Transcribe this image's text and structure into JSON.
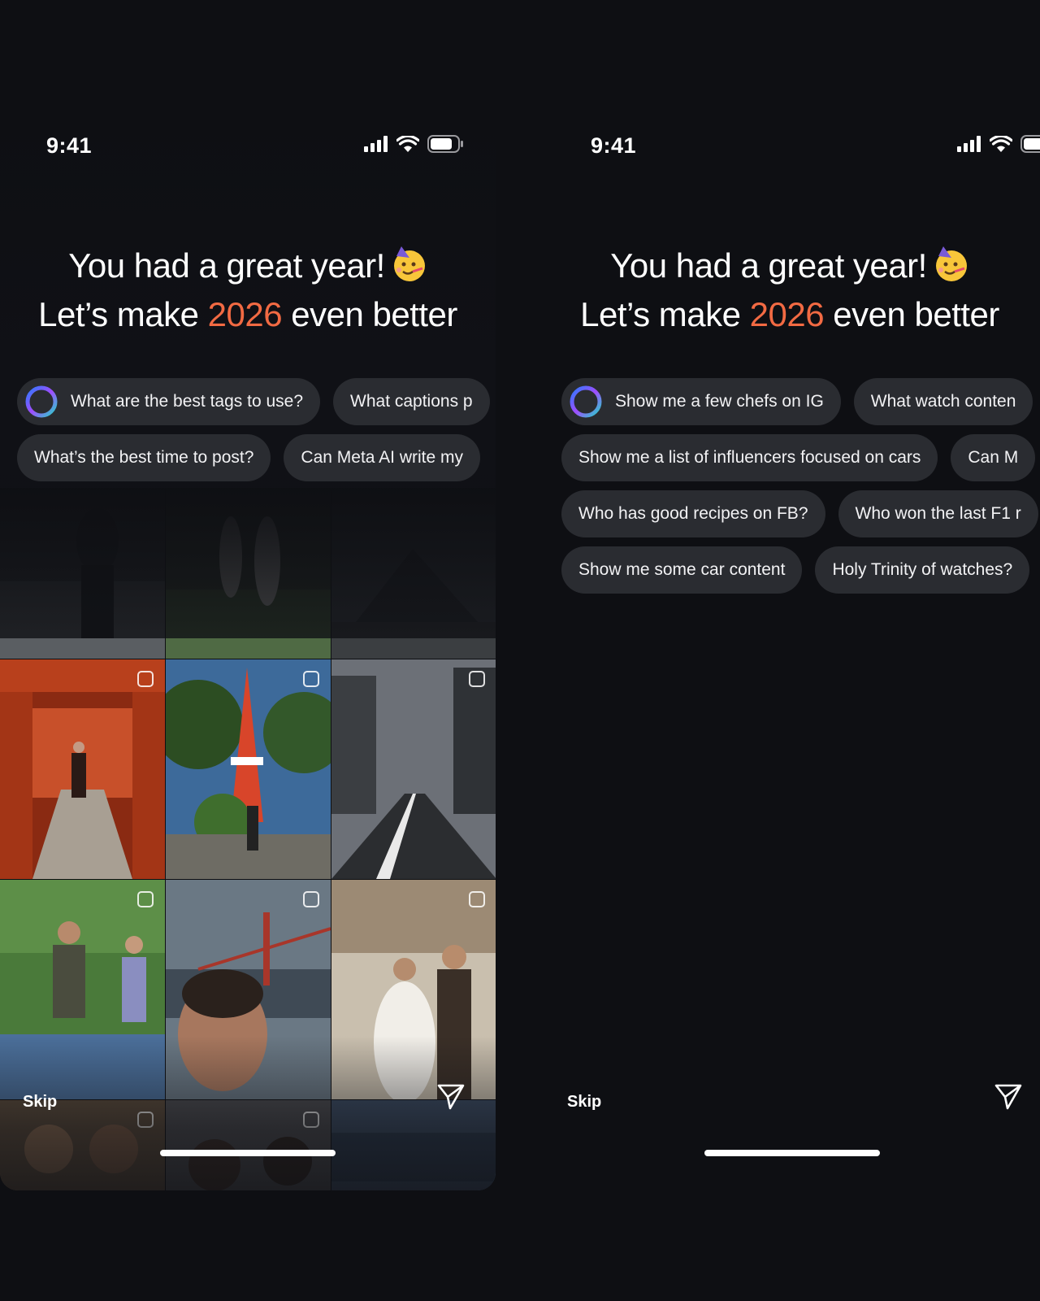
{
  "status_bar": {
    "time": "9:41"
  },
  "headline": {
    "line1": "You had a great year!",
    "line2_prefix": "Let’s make ",
    "line2_year": "2026",
    "line2_suffix": " even better",
    "emoji": "partying-face"
  },
  "left_screen": {
    "chips": [
      [
        "What are the best tags to use?",
        "What captions p"
      ],
      [
        "What’s the best time to post?",
        "Can Meta AI write my"
      ]
    ],
    "skip_label": "Skip",
    "send_icon": "send-icon"
  },
  "right_screen": {
    "chips": [
      [
        "Show me a few chefs on IG",
        "What watch conten"
      ],
      [
        "Show me a list of influencers focused on cars",
        "Can M"
      ],
      [
        "Who has good recipes on FB?",
        "Who won the last F1 r"
      ],
      [
        "Show me some car content",
        "Holy Trinity of watches?"
      ]
    ],
    "skip_label": "Skip",
    "send_icon": "send-icon"
  },
  "colors": {
    "accent": "#f26a43",
    "chip_bg": "#2a2c31",
    "background": "#0e0f13"
  }
}
